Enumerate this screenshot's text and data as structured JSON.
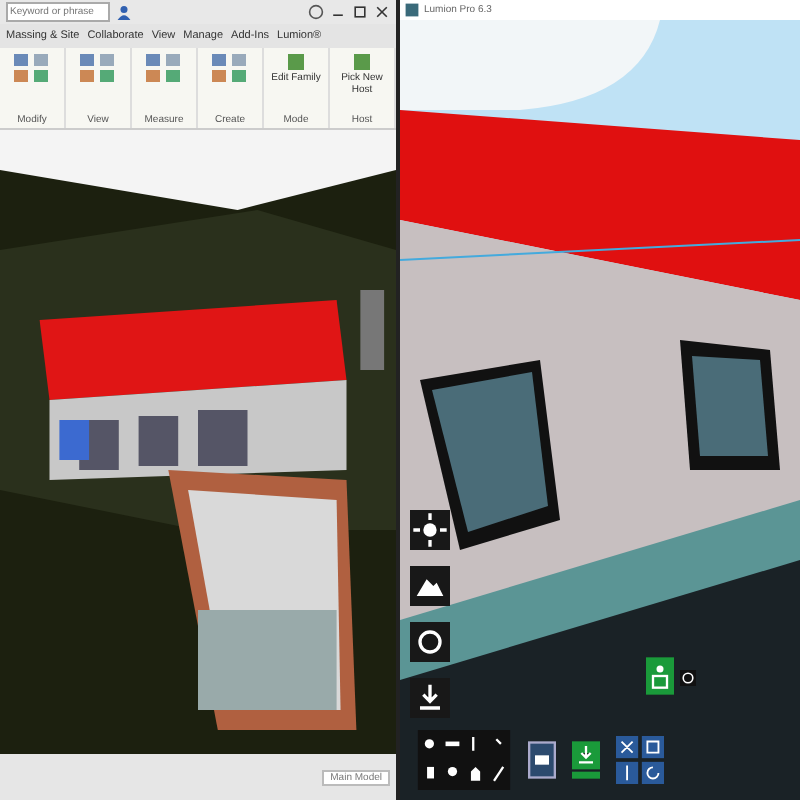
{
  "revit": {
    "search": {
      "placeholder": "Keyword or phrase"
    },
    "tabs": [
      {
        "label": "Massing & Site",
        "selected": false
      },
      {
        "label": "Collaborate",
        "selected": false
      },
      {
        "label": "View",
        "selected": false
      },
      {
        "label": "Manage",
        "selected": false
      },
      {
        "label": "Add-Ins",
        "selected": false
      },
      {
        "label": "Lumion®",
        "selected": false
      }
    ],
    "panels": [
      {
        "label": "Modify"
      },
      {
        "label": "View"
      },
      {
        "label": "Measure"
      },
      {
        "label": "Create"
      },
      {
        "label": "Mode",
        "buttons": [
          "Edit Family"
        ]
      },
      {
        "label": "Host",
        "buttons": [
          "Pick New Host"
        ]
      }
    ],
    "status_bar": {
      "model": "Main Model"
    }
  },
  "lumion": {
    "title": "Lumion Pro 6.3"
  }
}
